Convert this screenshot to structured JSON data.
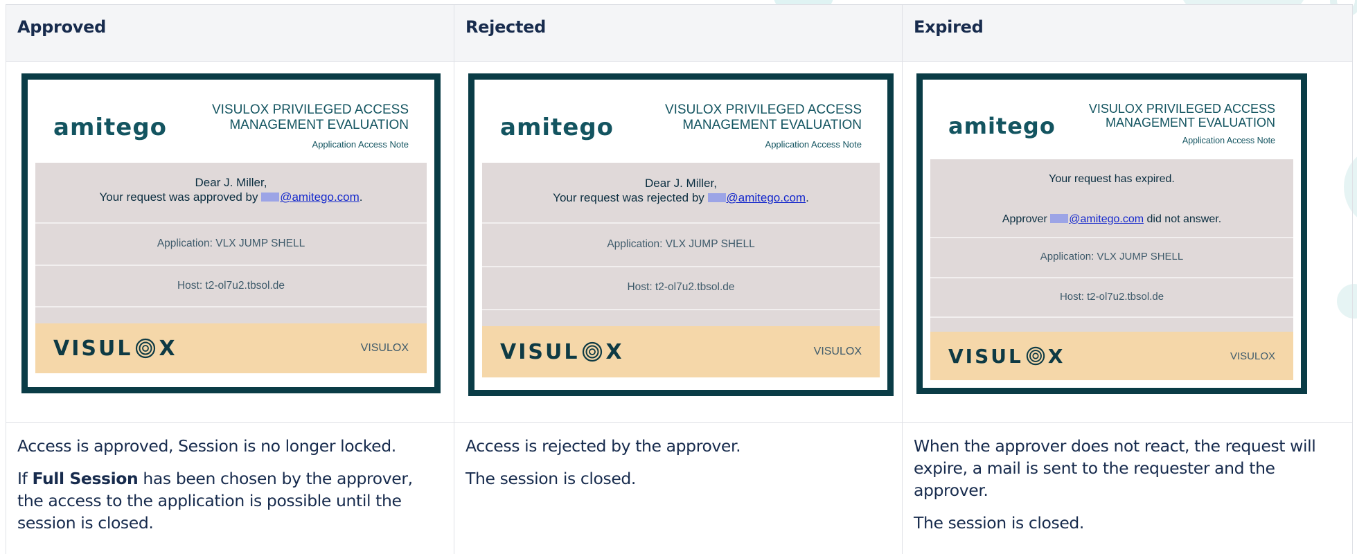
{
  "columns": [
    {
      "header": "Approved",
      "email": {
        "logo": "amitego",
        "title_line1": "VISULOX PRIVILEGED ACCESS",
        "title_line2": "MANAGEMENT EVALUATION",
        "subtitle": "Application Access Note",
        "msg_line1": "Dear J. Miller,",
        "msg_line2_prefix": "Your request was approved by ",
        "email_link": "@amitego.com",
        "msg_line2_suffix": ".",
        "application": "Application: VLX JUMP SHELL",
        "host": "Host: t2-ol7u2.tbsol.de",
        "footer_logo_left": "VISUL",
        "footer_logo_right": "X",
        "footer_text": "VISULOX"
      },
      "desc": {
        "p1": "Access is approved, Session is no longer locked.",
        "p2_prefix": "If ",
        "p2_bold": "Full Session",
        "p2_suffix": " has been chosen by the approver, the access to the application is possible until the session is closed."
      }
    },
    {
      "header": "Rejected",
      "email": {
        "logo": "amitego",
        "title_line1": "VISULOX PRIVILEGED ACCESS",
        "title_line2": "MANAGEMENT EVALUATION",
        "subtitle": "Application Access Note",
        "msg_line1": "Dear J. Miller,",
        "msg_line2_prefix": "Your request was rejected by ",
        "email_link": "@amitego.com",
        "msg_line2_suffix": ".",
        "application": "Application: VLX JUMP SHELL",
        "host": "Host: t2-ol7u2.tbsol.de",
        "footer_logo_left": "VISUL",
        "footer_logo_right": "X",
        "footer_text": "VISULOX"
      },
      "desc": {
        "p1": "Access is rejected by the approver.",
        "p2": "The session is closed."
      }
    },
    {
      "header": "Expired",
      "email": {
        "logo": "amitego",
        "title_line1": "VISULOX PRIVILEGED ACCESS",
        "title_line2": "MANAGEMENT EVALUATION",
        "subtitle": "Application Access Note",
        "msg_line1": "Your request has expired.",
        "msg_line2_prefix": "Approver ",
        "email_link": "@amitego.com",
        "msg_line2_suffix": " did not answer.",
        "application": "Application: VLX JUMP SHELL",
        "host": "Host: t2-ol7u2.tbsol.de",
        "footer_logo_left": "VISUL",
        "footer_logo_right": "X",
        "footer_text": "VISULOX"
      },
      "desc": {
        "p1": "When the approver does not react, the request will expire, a mail is sent to the requester and the approver.",
        "p2": "The session is closed."
      }
    }
  ],
  "colors": {
    "card_frame": "#0a3c46",
    "card_grey": "#e0d9d9",
    "card_footer": "#f5d7a9",
    "header_bg": "#f4f5f7",
    "link": "#1428cc"
  }
}
